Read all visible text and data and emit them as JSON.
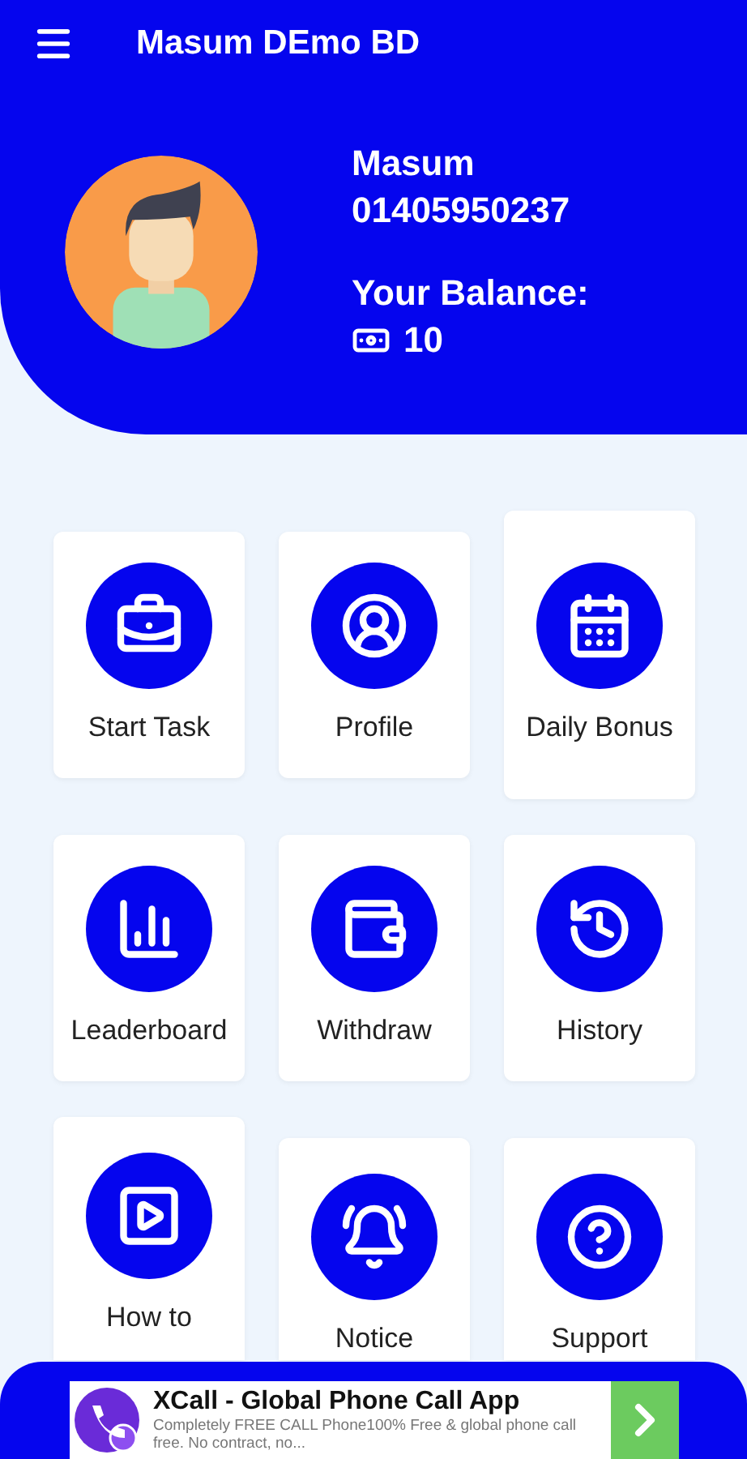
{
  "app_bar": {
    "title": "Masum DEmo BD"
  },
  "profile": {
    "name": "Masum",
    "phone": "01405950237",
    "balance_label": "Your Balance:",
    "balance": "10"
  },
  "tiles": [
    {
      "label": "Start Task"
    },
    {
      "label": "Profile"
    },
    {
      "label": "Daily Bonus"
    },
    {
      "label": "Leaderboard"
    },
    {
      "label": "Withdraw"
    },
    {
      "label": "History"
    },
    {
      "label": "How to"
    },
    {
      "label": "Notice"
    },
    {
      "label": "Support"
    }
  ],
  "ad": {
    "title": "XCall - Global Phone Call App",
    "description": "Completely FREE CALL Phone100% Free & global phone call free. No contract, no..."
  }
}
